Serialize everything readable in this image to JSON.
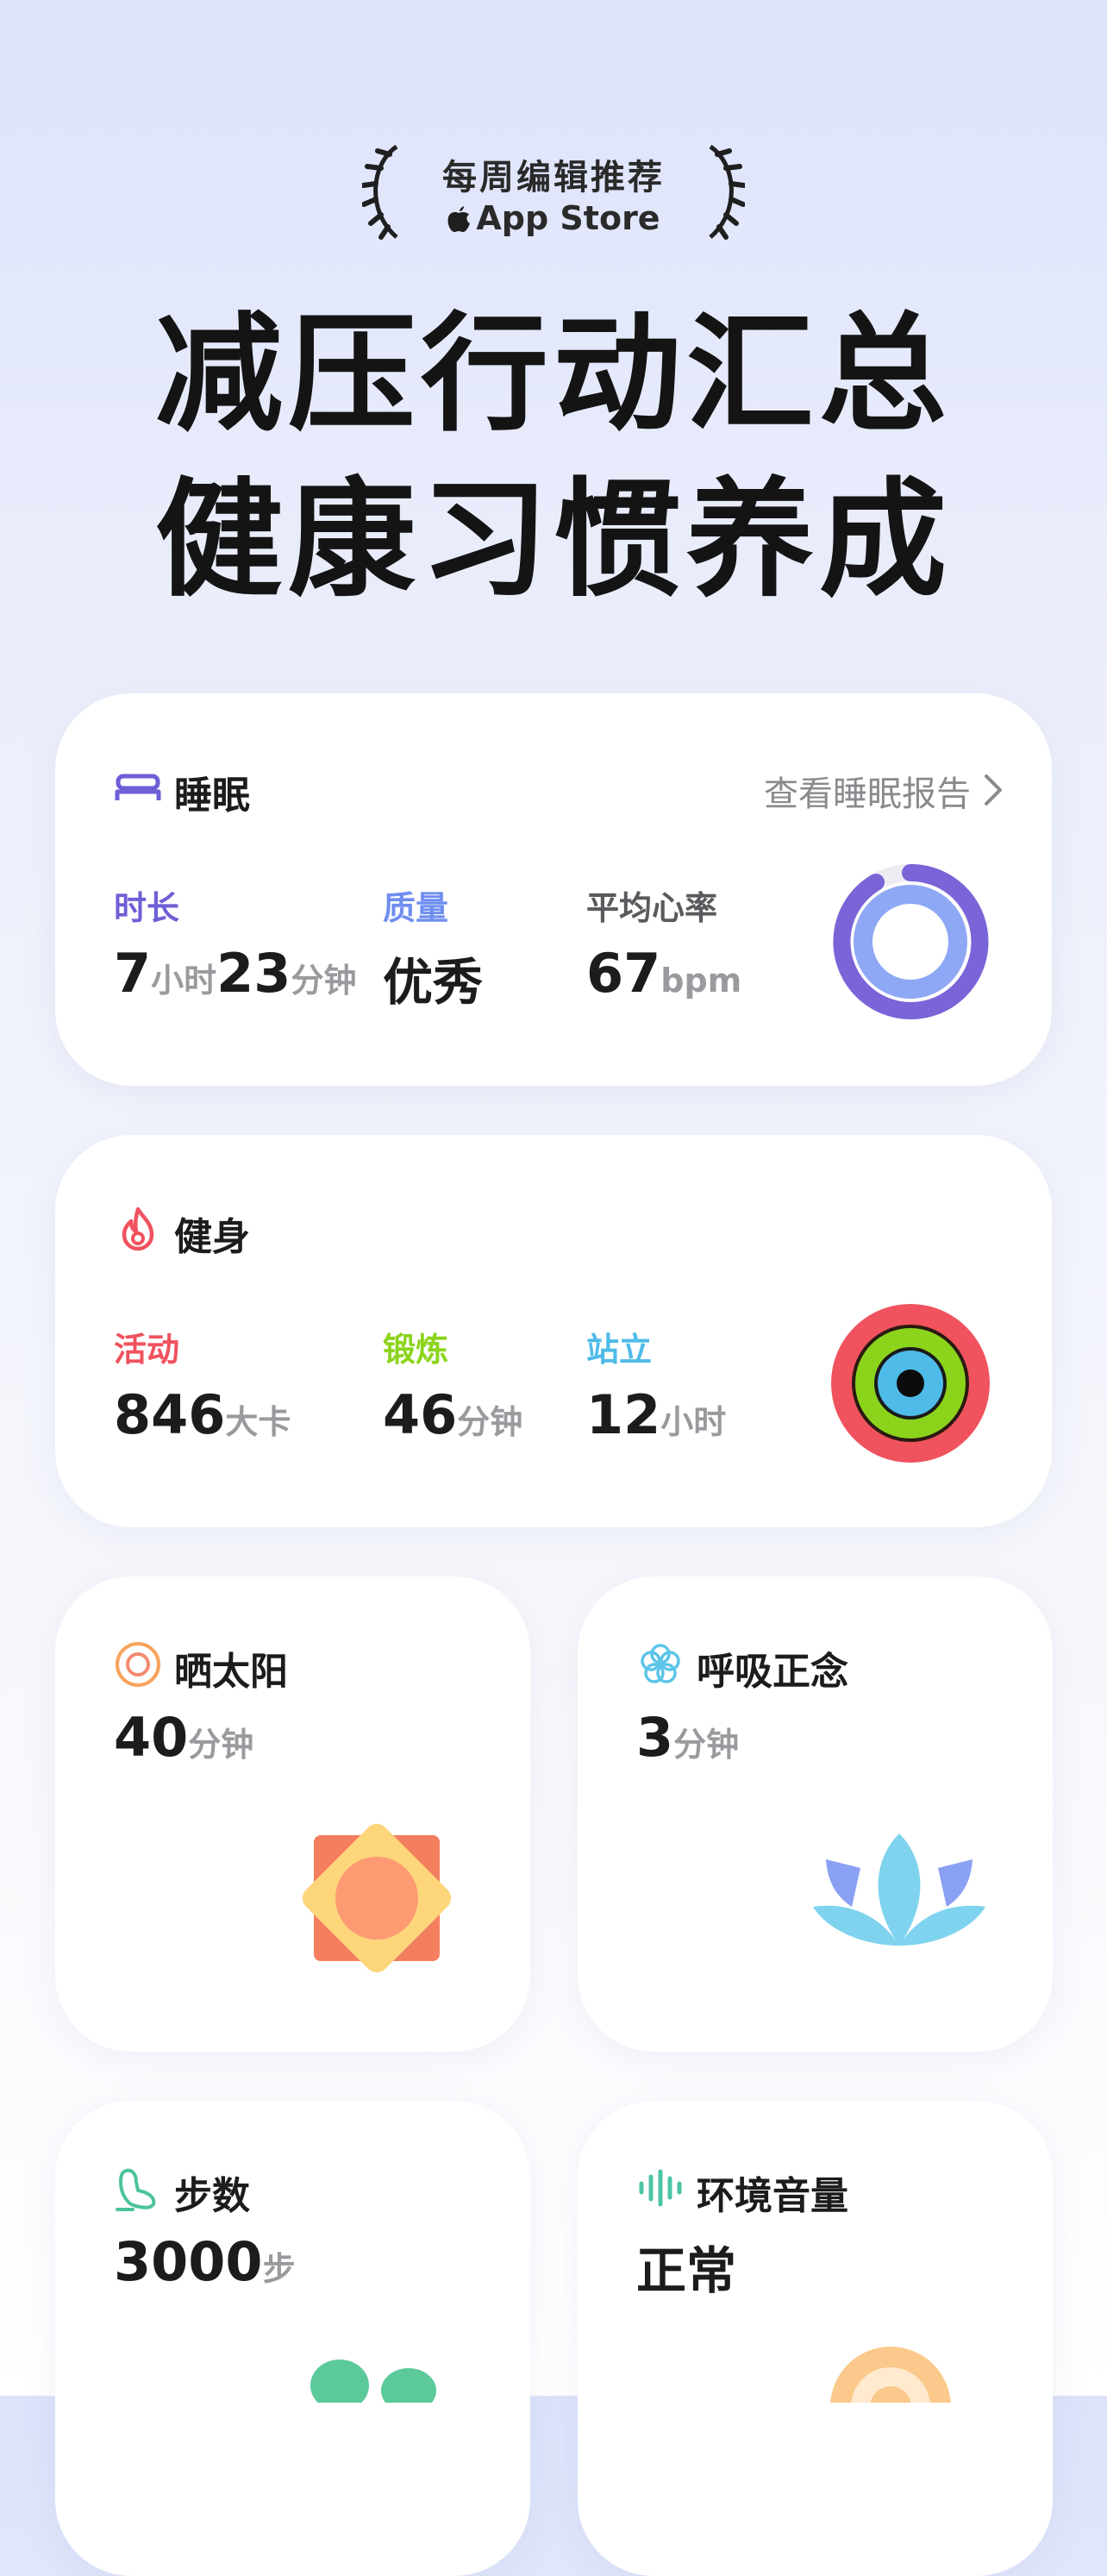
{
  "badge": {
    "line1": "每周编辑推荐",
    "line2": "App Store"
  },
  "headline": {
    "line1": "减压行动汇总",
    "line2": "健康习惯养成"
  },
  "sleep": {
    "title": "睡眠",
    "report_link": "查看睡眠报告",
    "metrics": [
      {
        "label": "时长",
        "v1": "7",
        "u1": "小时",
        "v2": "23",
        "u2": "分钟"
      },
      {
        "label": "质量",
        "v1": "优秀"
      },
      {
        "label": "平均心率",
        "v1": "67",
        "u1": "bpm"
      }
    ],
    "colors": {
      "duration": "#6e5fd6",
      "quality": "#6f8ef0",
      "heart": "#5a5a5e",
      "ring_outer": "#7b63d8",
      "ring_inner": "#8ea8f5"
    }
  },
  "fitness": {
    "title": "健身",
    "metrics": [
      {
        "label": "活动",
        "value": "846",
        "unit": "大卡"
      },
      {
        "label": "锻炼",
        "value": "46",
        "unit": "分钟"
      },
      {
        "label": "站立",
        "value": "12",
        "unit": "小时"
      }
    ],
    "colors": {
      "move": "#f0525e",
      "exercise": "#8cd41c",
      "stand": "#4fbbe8"
    }
  },
  "sun": {
    "title": "晒太阳",
    "value": "40",
    "unit": "分钟",
    "icon": "sun-icon"
  },
  "breath": {
    "title": "呼吸正念",
    "value": "3",
    "unit": "分钟",
    "icon": "lotus-icon"
  },
  "steps": {
    "title": "步数",
    "value": "3000",
    "unit": "步",
    "icon": "footprint-icon"
  },
  "noise": {
    "title": "环境音量",
    "value": "正常",
    "icon": "soundwave-icon"
  }
}
